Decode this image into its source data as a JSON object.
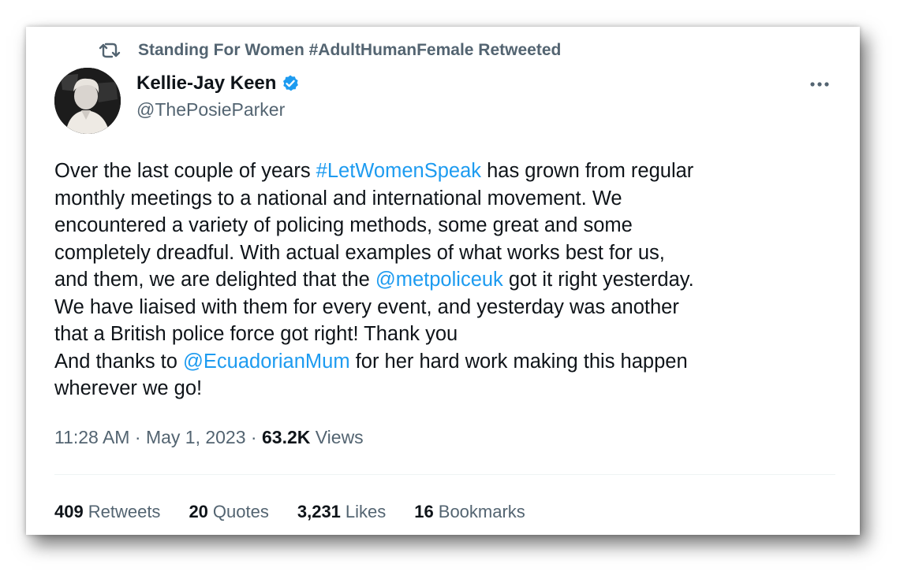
{
  "retweet": {
    "icon": "retweet-icon",
    "text": "Standing For Women #AdultHumanFemale Retweeted"
  },
  "author": {
    "display_name": "Kellie-Jay Keen",
    "handle": "@ThePosieParker",
    "verified_icon": "verified-badge-icon",
    "avatar_icon": "profile-photo"
  },
  "menu_icon": "more-options-icon",
  "tweet": {
    "lines": [
      [
        {
          "t": "Over the last couple of years "
        },
        {
          "t": "#LetWomenSpeak",
          "link": true
        },
        {
          "t": " has grown from regular"
        }
      ],
      [
        {
          "t": "monthly meetings to a national and international movement.  We"
        }
      ],
      [
        {
          "t": "encountered a variety of policing methods, some great and some"
        }
      ],
      [
        {
          "t": "completely dreadful.  With actual examples of what works best for us,"
        }
      ],
      [
        {
          "t": "and them, we are delighted that the "
        },
        {
          "t": "@metpoliceuk",
          "link": true
        },
        {
          "t": " got it right yesterday."
        }
      ],
      [
        {
          "t": "We have liaised with them for every event, and yesterday was another"
        }
      ],
      [
        {
          "t": "that a British police force got right!  Thank you"
        }
      ],
      [
        {
          "t": "And thanks to "
        },
        {
          "t": "@EcuadorianMum",
          "link": true
        },
        {
          "t": " for her hard work making this happen"
        }
      ],
      [
        {
          "t": "wherever we go!"
        }
      ]
    ]
  },
  "meta": {
    "time": "11:28 AM",
    "separator": " · ",
    "date": "May 1, 2023",
    "views_count": "63.2K",
    "views_label": " Views"
  },
  "stats": [
    {
      "num": "409",
      "label": "Retweets"
    },
    {
      "num": "20",
      "label": "Quotes"
    },
    {
      "num": "3,231",
      "label": "Likes"
    },
    {
      "num": "16",
      "label": "Bookmarks"
    }
  ],
  "colors": {
    "link": "#1d9bf0",
    "muted": "#536471",
    "text": "#0f1419"
  }
}
